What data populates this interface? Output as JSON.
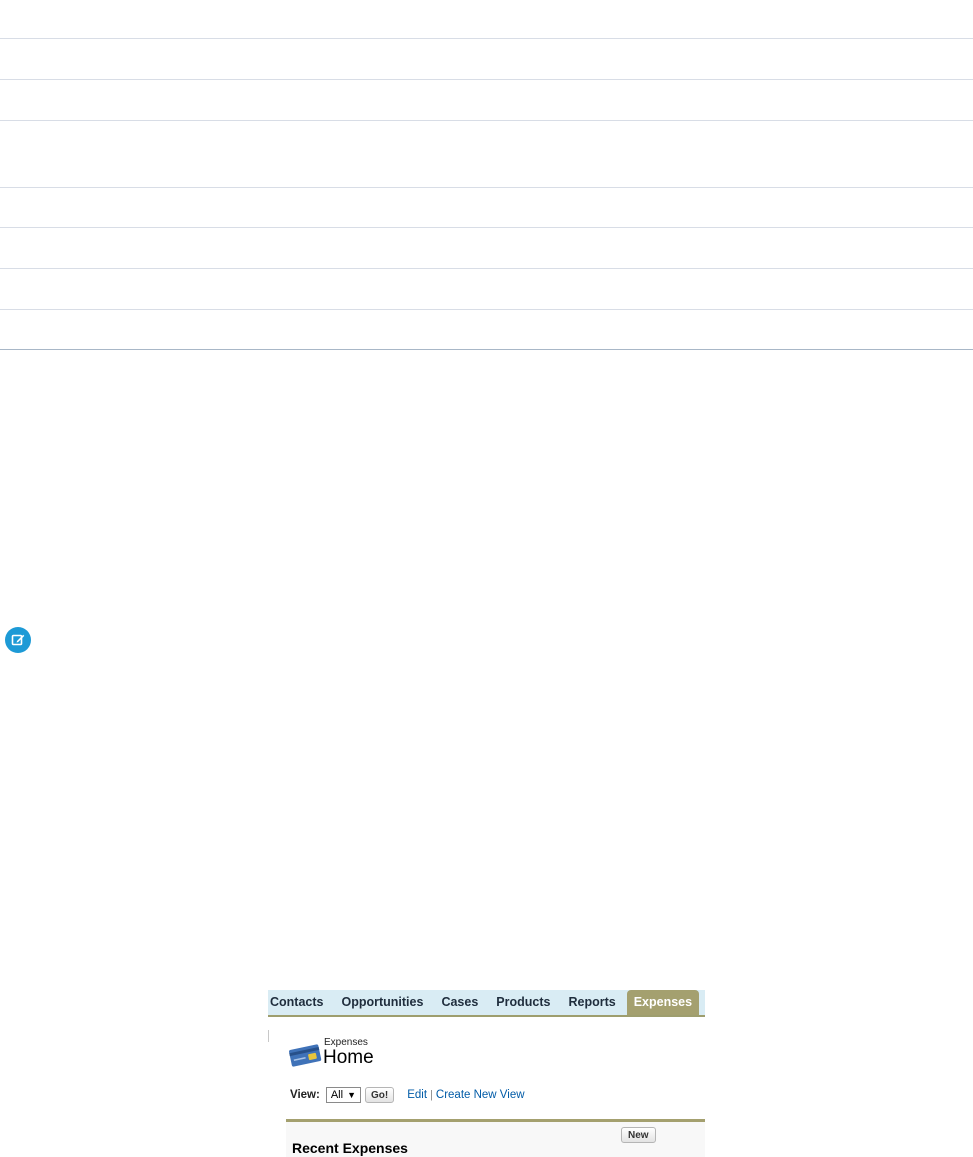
{
  "table": {
    "row_count": 8
  },
  "note": {
    "icon": "edit-note-icon",
    "color": "#1d9ad6"
  },
  "salesforce": {
    "tabs": [
      "Contacts",
      "Opportunities",
      "Cases",
      "Products",
      "Reports"
    ],
    "active_tab": "Expenses",
    "plus_tab": "+",
    "breadcrumb": "Expenses",
    "page_title": "Home",
    "view": {
      "label": "View:",
      "selected": "All",
      "go_label": "Go!",
      "edit_link": "Edit",
      "separator": "|",
      "create_link": "Create New View"
    },
    "recent": {
      "title": "Recent Expenses",
      "new_label": "New"
    },
    "colors": {
      "tabbar_bg": "#d9ecf4",
      "active_tab": "#a4a06f",
      "link": "#015ba7"
    }
  }
}
